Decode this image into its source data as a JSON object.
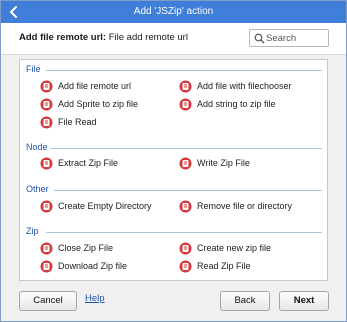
{
  "window": {
    "title": "Add 'JSZip' action"
  },
  "header": {
    "label_bold": "Add file remote url:",
    "label_rest": " File add remote url"
  },
  "search": {
    "placeholder": "Search"
  },
  "sections": [
    {
      "name": "File"
    },
    {
      "name": "Node"
    },
    {
      "name": "Other"
    },
    {
      "name": "Zip"
    }
  ],
  "items": {
    "file": [
      "Add file remote url",
      "Add file with filechooser",
      "Add Sprite to zip file",
      "Add string to zip file",
      "File Read"
    ],
    "node": [
      "Extract Zip File",
      "Write Zip File"
    ],
    "other": [
      "Create Empty Directory",
      "Remove file or directory"
    ],
    "zip": [
      "Close Zip File",
      "Create new zip file",
      "Download Zip file",
      "Read Zip File"
    ]
  },
  "footer": {
    "cancel": "Cancel",
    "help": "Help",
    "back": "Back",
    "next": "Next"
  },
  "colors": {
    "titlebar": "#3f7fd9",
    "section_text": "#1f55a8",
    "action_icon": "#d9373c"
  },
  "icons": {
    "action": "jszip-action-icon",
    "back": "back-arrow-icon",
    "search": "search-icon"
  }
}
